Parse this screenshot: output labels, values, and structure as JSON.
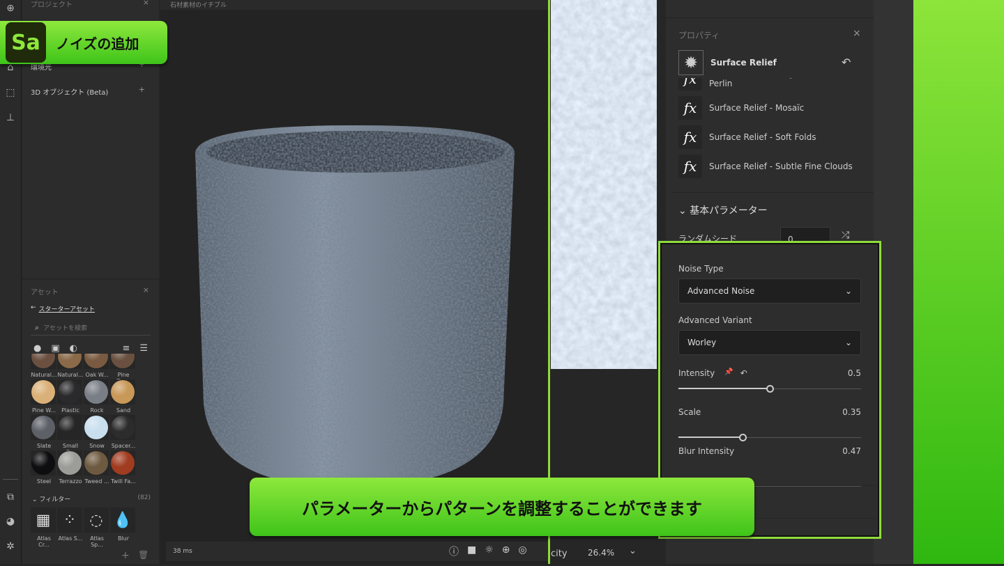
{
  "left_rail": {
    "icons": [
      "add-icon",
      "light-icon",
      "transform-icon",
      "stamp-icon",
      "render-settings-icon",
      "environment-icon",
      "plugins-icon"
    ]
  },
  "project_panel": {
    "title": "プロジェクト",
    "items": [
      {
        "label": "環境光"
      },
      {
        "label": "3D オブジェクト (Beta)"
      }
    ]
  },
  "assets_panel": {
    "title": "アセット",
    "back_link": "スターターアセット",
    "search_placeholder": "アセットを検索",
    "rows": [
      [
        {
          "label": "Natural...",
          "color": "#6b5040"
        },
        {
          "label": "Natural...",
          "color": "#8a6a48"
        },
        {
          "label": "Oak W...",
          "color": "#7a5a40"
        },
        {
          "label": "Pine Tre...",
          "color": "#6a5040"
        }
      ],
      [
        {
          "label": "Pine W...",
          "color": "#d9b078"
        },
        {
          "label": "Plastic",
          "color": "#2a2a2c"
        },
        {
          "label": "Rock",
          "color": "#7a7e86"
        },
        {
          "label": "Sand",
          "color": "#c89858"
        }
      ],
      [
        {
          "label": "Slate",
          "color": "#5e6068"
        },
        {
          "label": "Small G...",
          "color": "#262626"
        },
        {
          "label": "Snow",
          "color": "#c9dfee"
        },
        {
          "label": "Spacer...",
          "color": "#2c2c2c"
        }
      ],
      [
        {
          "label": "Steel",
          "color": "#0e0e10"
        },
        {
          "label": "Terrazzo",
          "color": "#9c9c98"
        },
        {
          "label": "Tweed ...",
          "color": "#6e5a40"
        },
        {
          "label": "Twill Fa...",
          "color": "#a03c20"
        }
      ]
    ],
    "filters_label": "フィルター",
    "filters_count": "(82)",
    "filters": [
      {
        "label": "Atlas Cr...",
        "icon": "checker-icon"
      },
      {
        "label": "Atlas S...",
        "icon": "dots-icon"
      },
      {
        "label": "Atlas Sp...",
        "icon": "dashed-circle-icon"
      },
      {
        "label": "Blur",
        "icon": "drop-icon"
      }
    ]
  },
  "viewport": {
    "title": "石材素材のイチブル",
    "render_time": "38 ms",
    "toolbar_icons": [
      "info-icon",
      "camera-icon",
      "light-icon",
      "environment-icon",
      "material-icon"
    ]
  },
  "view2d": {
    "opacity_label": "city",
    "zoom": "26.4%"
  },
  "properties": {
    "title": "プロパティ",
    "layer_name": "Surface Relief",
    "presets": [
      "Surface Relief - Large Smooth Perlin",
      "Surface Relief - Mosaïc",
      "Surface Relief - Soft Folds",
      "Surface Relief - Subtle Fine Clouds"
    ],
    "section": "基本パラメーター",
    "random_seed_label": "ランダムシード",
    "random_seed_value": "0",
    "noise_type_label": "Noise Type",
    "noise_type": "Advanced Noise",
    "variant_label": "Advanced Variant",
    "variant": "Worley",
    "sliders": [
      {
        "label": "Intensity",
        "value": "0.5",
        "fraction": 0.5
      },
      {
        "label": "Scale",
        "value": "0.35",
        "fraction": 0.35
      },
      {
        "label": "Blur Intensity",
        "value": "0.47",
        "fraction": 0.22
      }
    ]
  },
  "callouts": {
    "logo": "Sa",
    "title": "ノイズの追加",
    "caption": "パラメーターからパターンを調整することができます"
  },
  "colors": {
    "accent": "#8fdc3a",
    "callout_top": "#8ee83c",
    "callout_bottom": "#3fc41a"
  }
}
